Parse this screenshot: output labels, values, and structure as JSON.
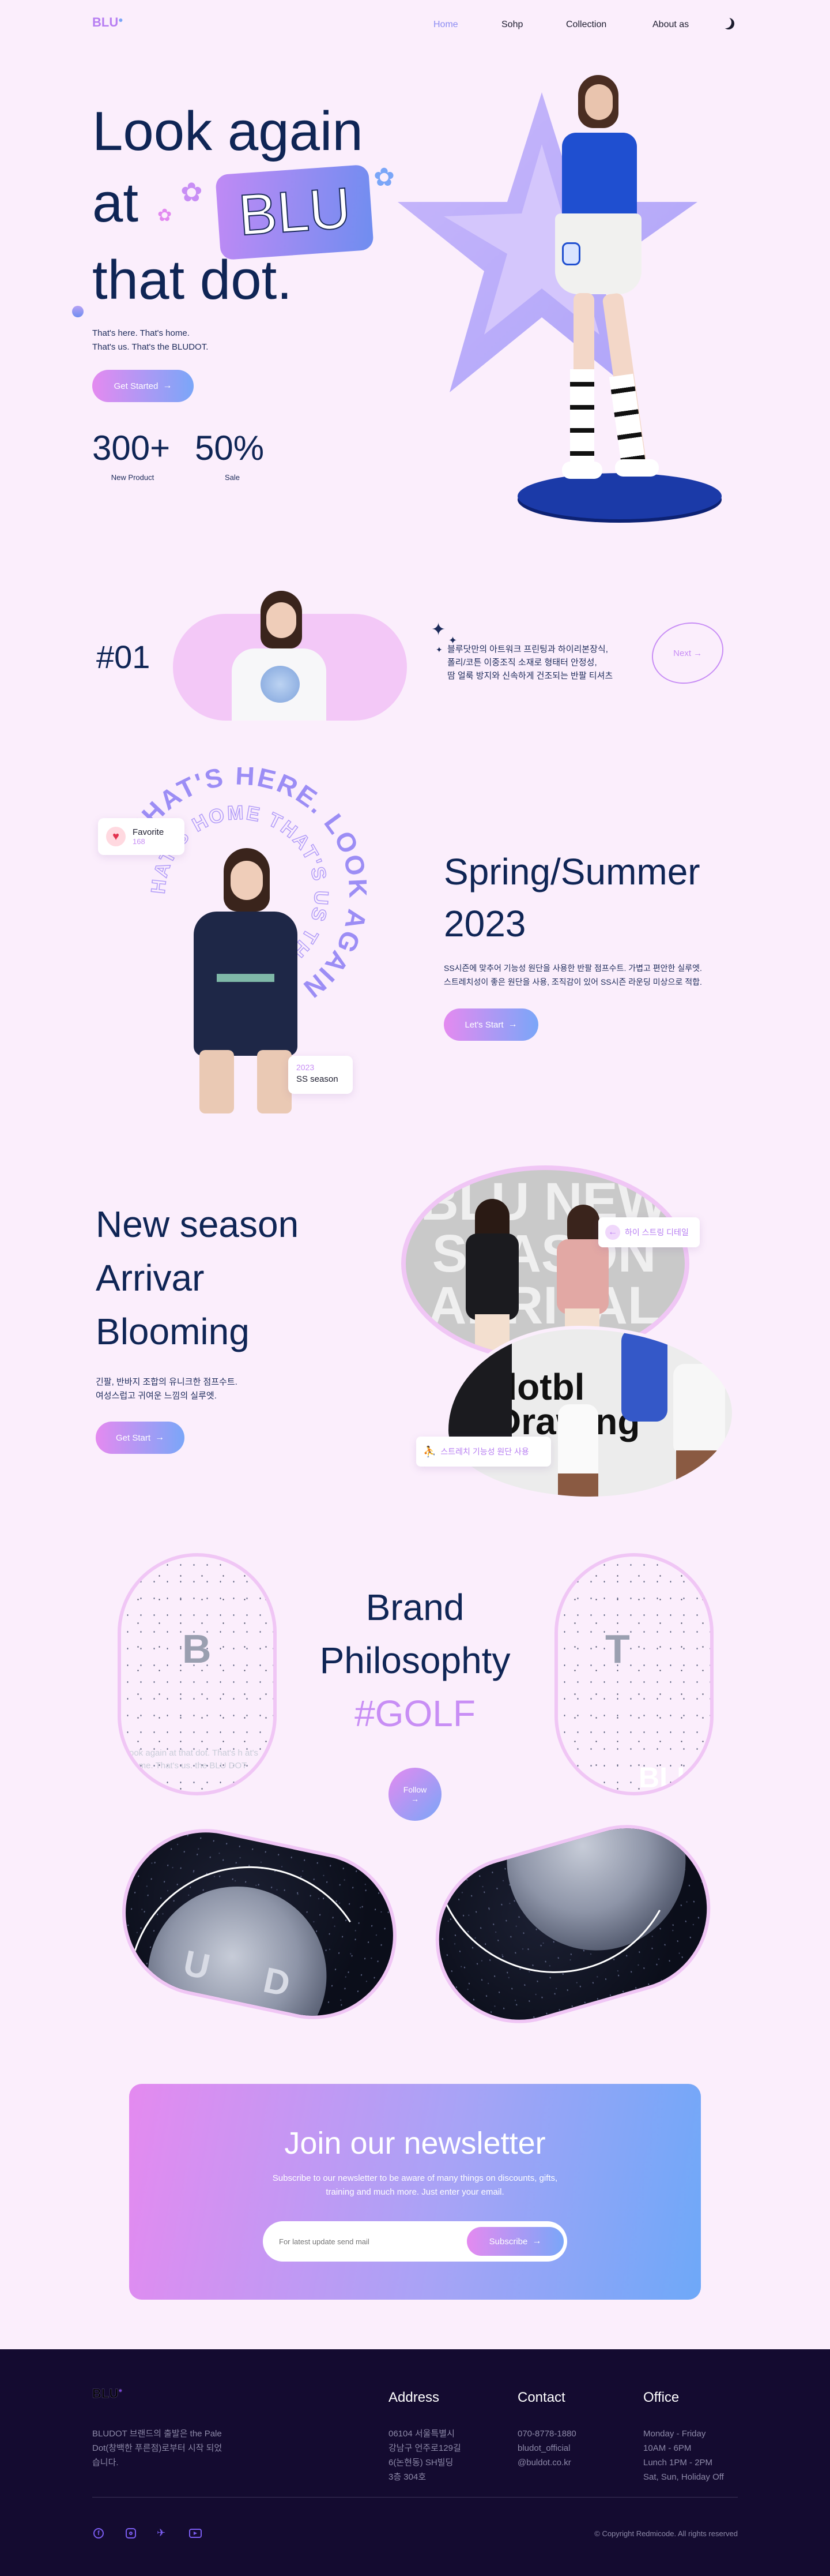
{
  "nav": {
    "logo": "BLU",
    "links": [
      "Home",
      "Sohp",
      "Collection",
      "About as"
    ]
  },
  "hero": {
    "title_line1": "Look again",
    "title_line2a": "at",
    "title_badge": "BLU",
    "title_line3": "that dot.",
    "subtitle_line1": "That's here. That's home.",
    "subtitle_line2": "That's us. That's the BLUDOT.",
    "cta": "Get Started",
    "stats": [
      {
        "value": "300+",
        "label": "New Product"
      },
      {
        "value": "50%",
        "label": "Sale"
      }
    ]
  },
  "feature": {
    "number": "#01",
    "text_line1": "블루닷만의 아트워크 프린팅과 하이리본장식,",
    "text_line2": "폴리/코튼 이중조직 소재로 형태터 안정성,",
    "text_line3": "땀 얼룩 방지와 신속하게 건조되는 반팔 티셔츠",
    "next": "Next"
  },
  "spring": {
    "ring_text": "THAT'S HERE. LOOK AGAIN AT THAT'S HOME THAT'S US",
    "favorite_label": "Favorite",
    "favorite_count": "168",
    "season_year": "2023",
    "season_label": "SS season",
    "title_line1": "Spring/Summer",
    "title_line2": "2023",
    "desc_line1": "SS시즌에 맞추어 기능성 원단을 사용한 반팔 점프수트. 가볍고 편안한 실루엣.",
    "desc_line2": "스트레치성이 좋은 원단을 사용, 조직감이 있어 SS시즌 라운딩 미상으로 적합.",
    "cta": "Let's Start"
  },
  "newseason": {
    "title_line1": "New season",
    "title_line2": "Arrivar",
    "title_line3": "Blooming",
    "desc_line1": "긴팔, 반바지 조합의 유니크한 점프수트.",
    "desc_line2": "여성스럽고 귀여운 느낌의 실루엣.",
    "cta": "Get Start",
    "tag1": "하이 스트링 디테일",
    "tag2": "스트레치 기능성 원단 사용",
    "photo1_bg_text": "BLU NEW SEASON ARRIVAL",
    "photo2_bg_text": "dotbl Drawing"
  },
  "brand": {
    "title_line1": "Brand",
    "title_line2": "Philosophty",
    "hashtag": "#GOLF",
    "follow": "Follow",
    "oval1_letter": "B",
    "oval1_text": "ook again at that dot. That's h at's home. That's us. the BLU DOT",
    "oval2_letter": "T",
    "oval2_corner": "BLU",
    "letters_bottom": "U D O"
  },
  "newsletter": {
    "title": "Join our newsletter",
    "desc_line1": "Subscribe to our newsletter to be aware of many things on discounts, gifts,",
    "desc_line2": "training and much more. Just enter your email.",
    "placeholder": "For latest update send mail",
    "button": "Subscribe"
  },
  "footer": {
    "logo": "BLU",
    "about_line1": "BLUDOT 브랜드의 출발은 the Pale",
    "about_line2": "Dot(창백한 푸른점)로부터 시작 되었",
    "about_line3": "습니다.",
    "address_title": "Address",
    "address": [
      "06104 서울특별시",
      "강남구 언주로129길",
      "6(논현동) SH빌딩",
      "3층 304호"
    ],
    "contact_title": "Contact",
    "contact": [
      "070-8778-1880",
      "bludot_official",
      "@buldot.co.kr"
    ],
    "office_title": "Office",
    "office": [
      "Monday - Friday",
      "10AM - 6PM",
      "Lunch 1PM - 2PM",
      "Sat, Sun, Holiday Off"
    ],
    "copyright": "© Copyright Redmicode. All rights reserved",
    "social_icons": [
      "facebook-icon",
      "instagram-icon",
      "twitter-icon",
      "youtube-icon"
    ]
  },
  "colors": {
    "background": "#fbeefc",
    "navy": "#0f2555",
    "pink": "#e48af0",
    "blue": "#7aa6f8",
    "footer": "#140b30"
  }
}
